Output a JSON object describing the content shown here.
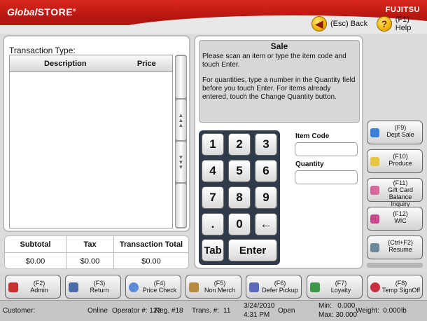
{
  "header": {
    "logo_prefix": "Global",
    "logo_suffix": "STORE",
    "brand": "FUJITSU",
    "back_label": "(Esc) Back",
    "help_label": "(F1) Help"
  },
  "transaction": {
    "type_label": "Transaction Type:",
    "columns": [
      "Description",
      "Price"
    ],
    "rows": []
  },
  "totals": {
    "headers": [
      "Subtotal",
      "Tax",
      "Transaction Total"
    ],
    "values": [
      "$0.00",
      "$0.00",
      "$0.00"
    ]
  },
  "sale": {
    "title": "Sale",
    "line1": "Please scan an item or type the item code and touch Enter.",
    "line2": "For quantities, type a number in the Quantity field before you touch Enter. For items already entered, touch the Change Quantity button."
  },
  "keypad": {
    "keys": [
      "1",
      "2",
      "3",
      "4",
      "5",
      "6",
      "7",
      "8",
      "9",
      ".",
      "0",
      "←"
    ],
    "tab": "Tab",
    "enter": "Enter"
  },
  "fields": {
    "item_code_label": "Item Code",
    "item_code_value": "",
    "quantity_label": "Quantity",
    "quantity_value": ""
  },
  "right_buttons": [
    {
      "key": "(F9)",
      "label": "Dept Sale",
      "icon": "dept-sale-icon",
      "color": "#3a7fd8"
    },
    {
      "key": "(F10)",
      "label": "Produce",
      "icon": "produce-icon",
      "color": "#e8c640"
    },
    {
      "key": "(F11)",
      "label": "Gift Card Balance Inquiry",
      "icon": "gift-card-icon",
      "color": "#d8689a"
    },
    {
      "key": "(F12)",
      "label": "WIC",
      "icon": "wic-icon",
      "color": "#c84a8a"
    },
    {
      "key": "(Ctrl+F2)",
      "label": "Resume",
      "icon": "resume-icon",
      "color": "#6a8a9a"
    }
  ],
  "bottom_buttons": [
    {
      "key": "(F2)",
      "label": "Admin",
      "icon": "admin-icon",
      "color": "#c83030"
    },
    {
      "key": "(F3)",
      "label": "Return",
      "icon": "return-icon",
      "color": "#4a6aa8"
    },
    {
      "key": "(F4)",
      "label": "Price Check",
      "icon": "price-check-icon",
      "color": "#5a8ad8"
    },
    {
      "key": "(F5)",
      "label": "Non Merch",
      "icon": "non-merch-icon",
      "color": "#b88a40"
    },
    {
      "key": "(F6)",
      "label": "Defer Pickup",
      "icon": "defer-pickup-icon",
      "color": "#5a6ab8"
    },
    {
      "key": "(F7)",
      "label": "Loyalty",
      "icon": "loyalty-icon",
      "color": "#3a9a4a"
    },
    {
      "key": "(F8)",
      "label": "Temp SignOff",
      "icon": "temp-signoff-icon",
      "color": "#c83040"
    }
  ],
  "status": {
    "customer": "Customer:",
    "online": "Online",
    "operator": "Operator #: 123",
    "register": "Reg. #18",
    "trans": "Trans. #:",
    "trans_no": "11",
    "date": "3/24/2010",
    "time": "4:31 PM",
    "state": "Open",
    "min": "Min:   0.000",
    "max": "Max: 30.000",
    "weight": "Weight:  0.000",
    "unit": "lb"
  }
}
